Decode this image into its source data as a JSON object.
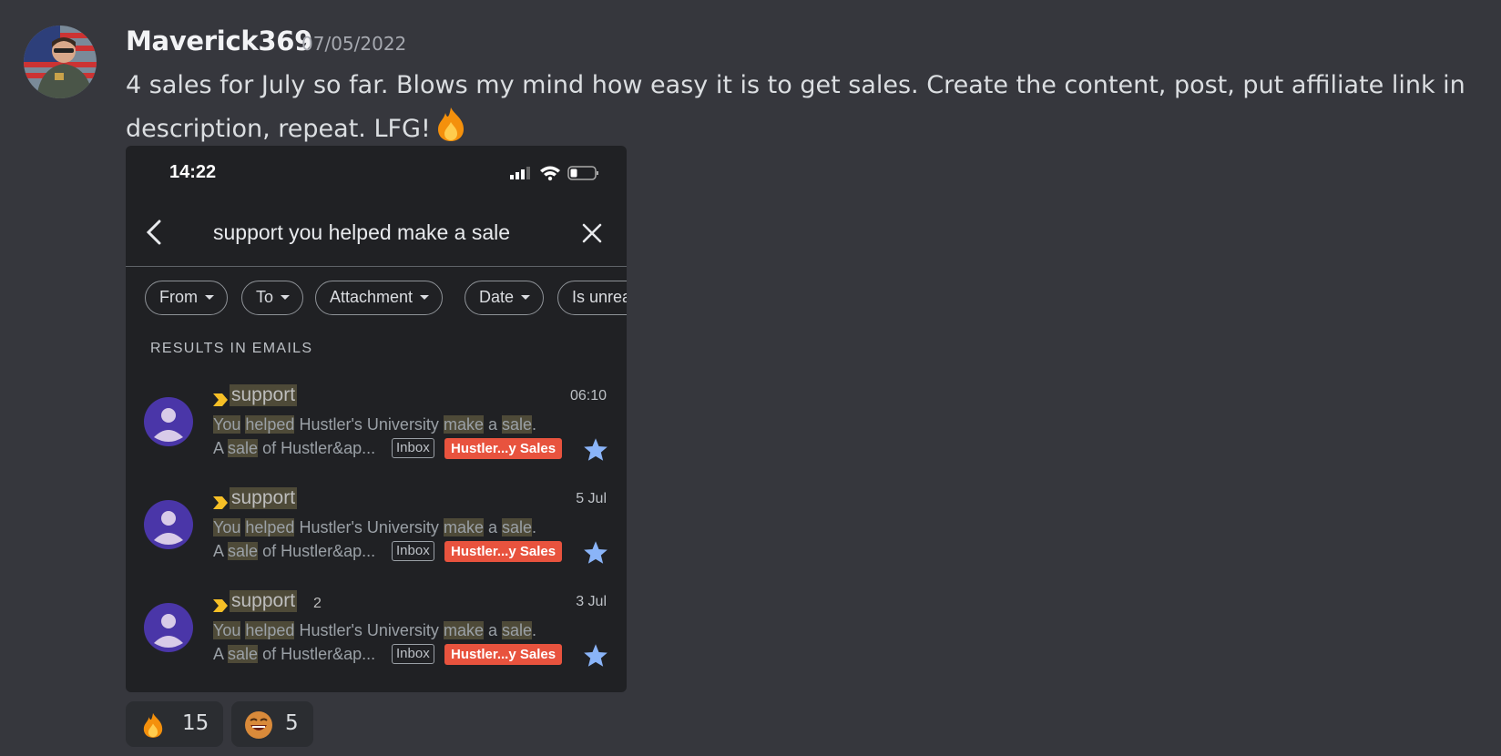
{
  "message": {
    "author": "Maverick369",
    "timestamp": "07/05/2022",
    "text": "4 sales for July so far. Blows my mind how easy it is to get sales. Create the content, post, put affiliate link in description, repeat. LFG!"
  },
  "attachment": {
    "status_time": "14:22",
    "search_query": "support you helped make a sale",
    "filters": [
      "From",
      "To",
      "Attachment",
      "Date",
      "Is unrea"
    ],
    "section_label": "RESULTS IN EMAILS",
    "results": [
      {
        "sender": "support",
        "count": "",
        "time": "06:10",
        "subject": [
          "You",
          "helped",
          "Hustler's University",
          "make",
          "a",
          "sale",
          "."
        ],
        "snippet": [
          "A",
          "sale",
          "of Hustler&ap..."
        ],
        "tag": "Inbox",
        "label": "Hustler...y Sales"
      },
      {
        "sender": "support",
        "count": "",
        "time": "5 Jul",
        "subject": [
          "You",
          "helped",
          "Hustler's University",
          "make",
          "a",
          "sale",
          "."
        ],
        "snippet": [
          "A",
          "sale",
          "of Hustler&ap..."
        ],
        "tag": "Inbox",
        "label": "Hustler...y Sales"
      },
      {
        "sender": "support",
        "count": "2",
        "time": "3 Jul",
        "subject": [
          "You",
          "helped",
          "Hustler's University",
          "make",
          "a",
          "sale",
          "."
        ],
        "snippet": [
          "A",
          "sale",
          "of Hustler&ap..."
        ],
        "tag": "Inbox",
        "label": "Hustler...y Sales"
      }
    ]
  },
  "reactions": [
    {
      "emoji": "fire-icon",
      "count": "15"
    },
    {
      "emoji": "laughing-face-icon",
      "count": "5"
    }
  ],
  "colors": {
    "background": "#36373d",
    "label_red": "#e8533e",
    "avatar_purple": "#4a36a8",
    "star_blue": "#8ab4f8",
    "importance_yellow": "#f6bf26"
  }
}
